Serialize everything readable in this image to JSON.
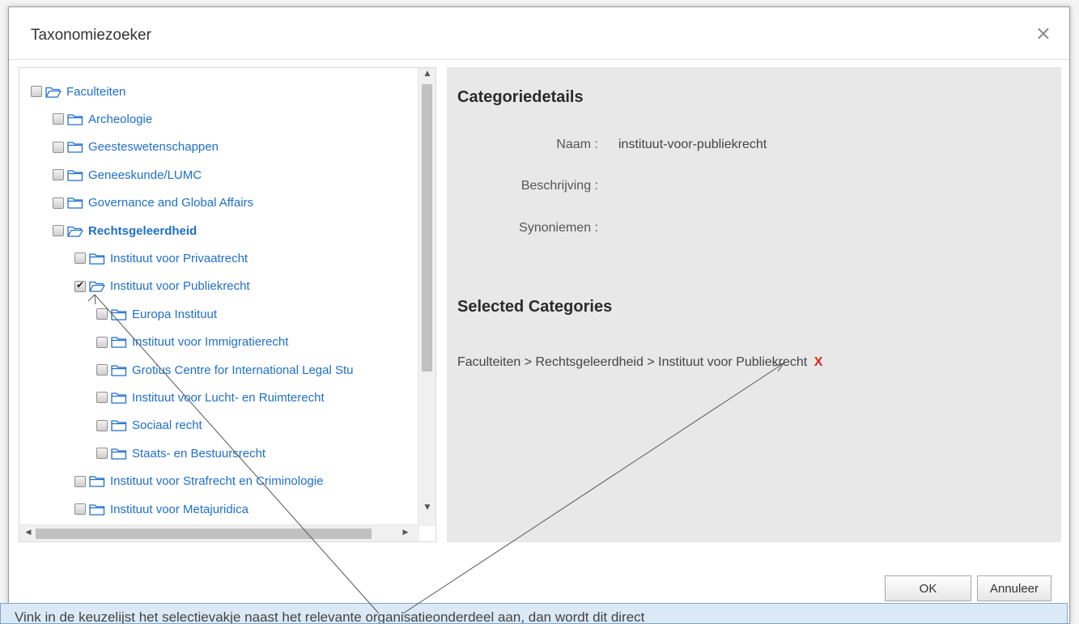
{
  "dialog": {
    "title": "Taxonomiezoeker",
    "close_glyph": "×"
  },
  "tree": {
    "nodes": [
      {
        "label": "Faculteiten",
        "level": 0,
        "checked": false,
        "open": true,
        "bold": false
      },
      {
        "label": "Archeologie",
        "level": 1,
        "checked": false,
        "open": false,
        "bold": false
      },
      {
        "label": "Geesteswetenschappen",
        "level": 1,
        "checked": false,
        "open": false,
        "bold": false
      },
      {
        "label": "Geneeskunde/LUMC",
        "level": 1,
        "checked": false,
        "open": false,
        "bold": false
      },
      {
        "label": "Governance and Global Affairs",
        "level": 1,
        "checked": false,
        "open": false,
        "bold": false
      },
      {
        "label": "Rechtsgeleerdheid",
        "level": 1,
        "checked": false,
        "open": true,
        "bold": true
      },
      {
        "label": "Instituut voor Privaatrecht",
        "level": 2,
        "checked": false,
        "open": false,
        "bold": false
      },
      {
        "label": "Instituut voor Publiekrecht",
        "level": 2,
        "checked": true,
        "open": true,
        "bold": false
      },
      {
        "label": "Europa Instituut",
        "level": 3,
        "checked": false,
        "open": false,
        "bold": false
      },
      {
        "label": "Instituut voor Immigratierecht",
        "level": 3,
        "checked": false,
        "open": false,
        "bold": false
      },
      {
        "label": "Grotius Centre for International Legal Stu",
        "level": 3,
        "checked": false,
        "open": false,
        "bold": false
      },
      {
        "label": "Instituut voor Lucht- en Ruimterecht",
        "level": 3,
        "checked": false,
        "open": false,
        "bold": false
      },
      {
        "label": "Sociaal recht",
        "level": 3,
        "checked": false,
        "open": false,
        "bold": false
      },
      {
        "label": "Staats- en Bestuursrecht",
        "level": 3,
        "checked": false,
        "open": false,
        "bold": false
      },
      {
        "label": "Instituut voor Strafrecht en Criminologie",
        "level": 2,
        "checked": false,
        "open": false,
        "bold": false
      },
      {
        "label": "Instituut voor Metajuridica",
        "level": 2,
        "checked": false,
        "open": false,
        "bold": false
      }
    ]
  },
  "details": {
    "heading": "Categoriedetails",
    "name_label": "Naam :",
    "name_value": "instituut-voor-publiekrecht",
    "description_label": "Beschrijving :",
    "synonyms_label": "Synoniemen :"
  },
  "selected": {
    "heading": "Selected Categories",
    "path": "Faculteiten > Rechtsgeleerdheid > Instituut voor Publiekrecht",
    "remove_glyph": "X"
  },
  "buttons": {
    "ok": "OK",
    "cancel": "Annuleer"
  },
  "tooltip": {
    "text": "Vink in de keuzelijst het selectievakje naast het relevante organisatieonderdeel aan, dan wordt dit direct"
  },
  "colors": {
    "link": "#1f6fcb",
    "remove": "#d9261c",
    "tooltip_bg": "#dbe9f7"
  }
}
